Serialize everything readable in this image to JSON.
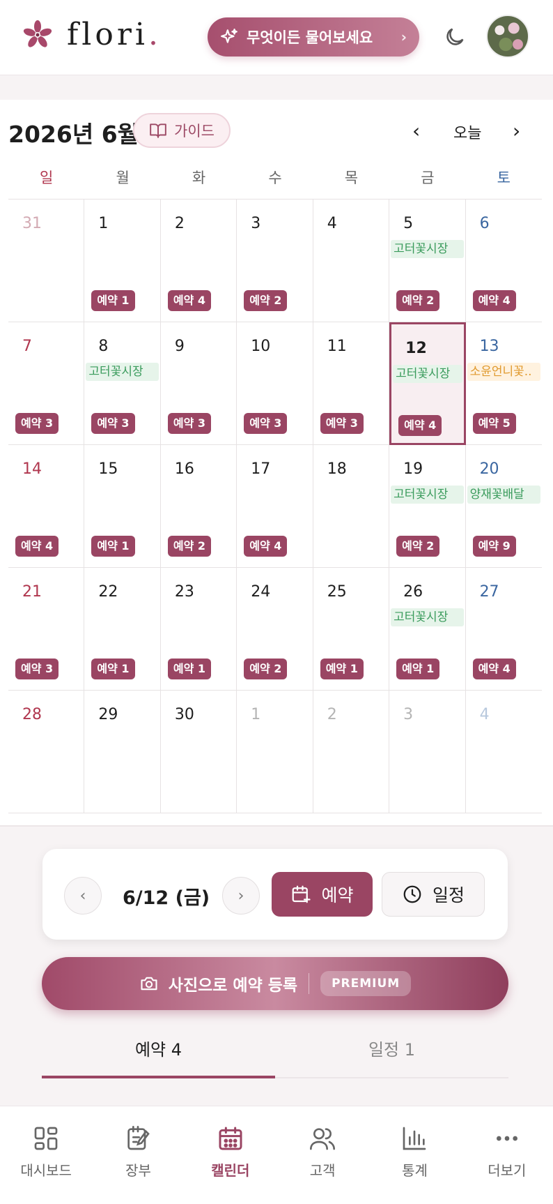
{
  "header": {
    "logo_text": "flori",
    "logo_dot": ".",
    "ask_label": "무엇이든 물어보세요",
    "theme_icon": "moon-icon"
  },
  "calendar": {
    "title": "2026년 6월",
    "guide_label": "가이드",
    "today_label": "오늘",
    "weekdays": [
      "일",
      "월",
      "화",
      "수",
      "목",
      "금",
      "토"
    ],
    "cells": [
      {
        "day": "31",
        "other": true
      },
      {
        "day": "1",
        "badge": "예약 1"
      },
      {
        "day": "2",
        "badge": "예약 4"
      },
      {
        "day": "3",
        "badge": "예약 2"
      },
      {
        "day": "4"
      },
      {
        "day": "5",
        "event": "고터꽃시장",
        "event_color": "green",
        "badge": "예약 2"
      },
      {
        "day": "6",
        "badge": "예약 4"
      },
      {
        "day": "7",
        "badge": "예약 3"
      },
      {
        "day": "8",
        "event": "고터꽃시장",
        "event_color": "green",
        "badge": "예약 3"
      },
      {
        "day": "9",
        "badge": "예약 3"
      },
      {
        "day": "10",
        "badge": "예약 3"
      },
      {
        "day": "11",
        "badge": "예약 3"
      },
      {
        "day": "12",
        "event": "고터꽃시장",
        "event_color": "green",
        "badge": "예약 4",
        "selected": true
      },
      {
        "day": "13",
        "event": "소윤언니꽃..",
        "event_color": "orange",
        "badge": "예약 5"
      },
      {
        "day": "14",
        "badge": "예약 4"
      },
      {
        "day": "15",
        "badge": "예약 1"
      },
      {
        "day": "16",
        "badge": "예약 2"
      },
      {
        "day": "17",
        "badge": "예약 4"
      },
      {
        "day": "18"
      },
      {
        "day": "19",
        "event": "고터꽃시장",
        "event_color": "green",
        "badge": "예약 2"
      },
      {
        "day": "20",
        "event": "양재꽃배달",
        "event_color": "green",
        "badge": "예약 9"
      },
      {
        "day": "21",
        "badge": "예약 3"
      },
      {
        "day": "22",
        "badge": "예약 1"
      },
      {
        "day": "23",
        "badge": "예약 1"
      },
      {
        "day": "24",
        "badge": "예약 2"
      },
      {
        "day": "25",
        "badge": "예약 1"
      },
      {
        "day": "26",
        "event": "고터꽃시장",
        "event_color": "green",
        "badge": "예약 1"
      },
      {
        "day": "27",
        "badge": "예약 4"
      },
      {
        "day": "28"
      },
      {
        "day": "29"
      },
      {
        "day": "30"
      },
      {
        "day": "1",
        "other": true
      },
      {
        "day": "2",
        "other": true
      },
      {
        "day": "3",
        "other": true
      },
      {
        "day": "4",
        "other": true
      }
    ]
  },
  "panel": {
    "date_label": "6/12 (금)",
    "reserve_label": "예약",
    "schedule_label": "일정"
  },
  "photo": {
    "label": "사진으로 예약 등록",
    "premium": "PREMIUM"
  },
  "tabs": [
    {
      "label": "예약 4",
      "active": true
    },
    {
      "label": "일정 1",
      "active": false
    }
  ],
  "bottom_nav": [
    {
      "label": "대시보드",
      "icon": "dashboard-icon"
    },
    {
      "label": "장부",
      "icon": "ledger-icon"
    },
    {
      "label": "캘린더",
      "icon": "calendar-icon",
      "active": true
    },
    {
      "label": "고객",
      "icon": "customers-icon"
    },
    {
      "label": "통계",
      "icon": "stats-icon"
    },
    {
      "label": "더보기",
      "icon": "more-icon"
    }
  ],
  "colors": {
    "accent": "#9a4563",
    "sunday": "#b0364e",
    "saturday": "#3a66a0",
    "event_green": "#3a9b5c",
    "event_orange": "#e09a2e"
  }
}
